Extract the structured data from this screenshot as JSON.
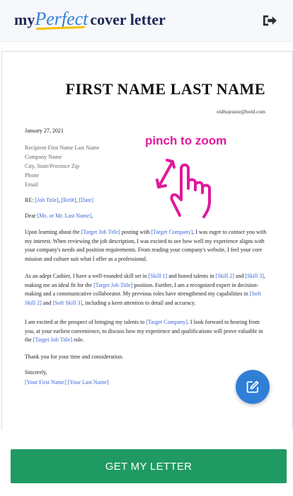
{
  "header": {
    "logo": {
      "part1": "my",
      "part2": "Perfect",
      "part3": "cover letter"
    },
    "logout_icon": "logout-icon"
  },
  "document": {
    "name": "FIRST NAME LAST NAME",
    "email": "eidhsjeueie@bold.com",
    "date": "January 27, 2021",
    "recipient": [
      "Recipient First Name Last Name",
      "Company Name",
      "City, State/Province Zip",
      "Phone",
      "Email"
    ],
    "re": {
      "label": "RE: ",
      "job_title": "[Job Title]",
      "sep1": ", ",
      "ref": "[Ref#]",
      "sep2": ", ",
      "date": "[Date]"
    },
    "salutation": {
      "prefix": "Dear ",
      "name": "[Ms. or Mr. Last Name]",
      "suffix": ","
    },
    "p1": {
      "a": "Upon learning about the ",
      "b": "[Target Job Title]",
      "c": " posting with ",
      "d": "[Target Company]",
      "e": ", I was eager to contact you with my interest. When reviewing the job description, I was excited to see how well my experience aligns with your company's needs and position requirements. From reading your company's website, I feel your core mission and culture suit what I offer as a professional."
    },
    "p2": {
      "a": "As an adept Cashier, I have a well-rounded skill set in ",
      "b": "[Skill 1]",
      "c": " and honed talents in ",
      "d": "[Skill 2]",
      "e": " and ",
      "f": "[Skill 3]",
      "g": ", making me an ideal fit for the ",
      "h": "[Target Job Title]",
      "i": " position. Further, I am a recognized expert in decision-making and a communicative collaborator. My previous roles have strengthened my capabilities in ",
      "j": "[Soft Skill 2]",
      "k": " and ",
      "l": "[Soft Skill 3]",
      "m": ", including a keen attention to detail and accuracy."
    },
    "p3": {
      "a": "I am excited at the prospect of bringing my talents to ",
      "b": "[Target Company]",
      "c": ". I look forward to hearing from you, at your earliest convenience, to discuss how my experience and qualifications will prove valuable in the ",
      "d": "[Target Job Title]",
      "e": " role."
    },
    "thanks": "Thank you for your time and consideration.",
    "closing": "Sincerely,",
    "signature": "[Your First Name] [Your Last Name]"
  },
  "overlay": {
    "zoom_hint": "pinch to zoom",
    "hand_icon": "pinch-hand-icon",
    "hint_color": "#e0199c"
  },
  "fab": {
    "icon": "edit-icon",
    "color": "#2f7fd6"
  },
  "cta": {
    "label": "GET MY LETTER",
    "color": "#1f9a62"
  }
}
